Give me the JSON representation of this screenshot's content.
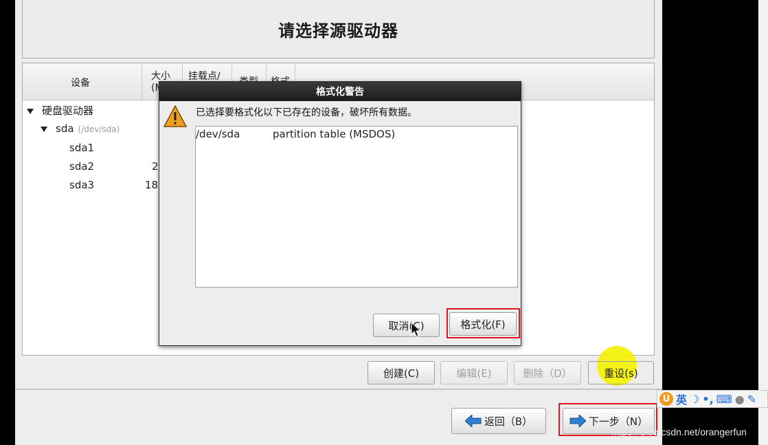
{
  "header": {
    "title": "请选择源驱动器"
  },
  "tree": {
    "columns": {
      "device": "设备",
      "size": "大小",
      "size_unit": "(M",
      "mount": "挂载点/",
      "type": "类型",
      "format": "格式"
    },
    "rows": [
      {
        "label": "硬盘驱动器"
      },
      {
        "label": "sda",
        "path": "(/dev/sda)"
      },
      {
        "label": "sda1",
        "size": ""
      },
      {
        "label": "sda2",
        "size": "2"
      },
      {
        "label": "sda3",
        "size": "18"
      }
    ]
  },
  "actions": {
    "create": "创建(C)",
    "edit": "编辑(E)",
    "delete": "删除（D）",
    "reset": "重设(s)"
  },
  "nav": {
    "back": "返回（B）",
    "next": "下一步（N）"
  },
  "dialog": {
    "title": "格式化警告",
    "message": "已选择要格式化以下已存在的设备，破坏所有数据。",
    "items": [
      {
        "device": "/dev/sda",
        "description": "partition table (MSDOS)"
      }
    ],
    "cancel": "取消(C)",
    "format": "格式化(F)"
  },
  "ime": {
    "logo": "U",
    "mode": "英"
  },
  "watermark": "https://blog.csdn.net/orangerfun",
  "colors": {
    "highlight_yellow": "#f4f100",
    "annotation_red": "#e0141e",
    "warning_orange": "#f0a020",
    "arrow_blue": "#2f7fd3"
  }
}
